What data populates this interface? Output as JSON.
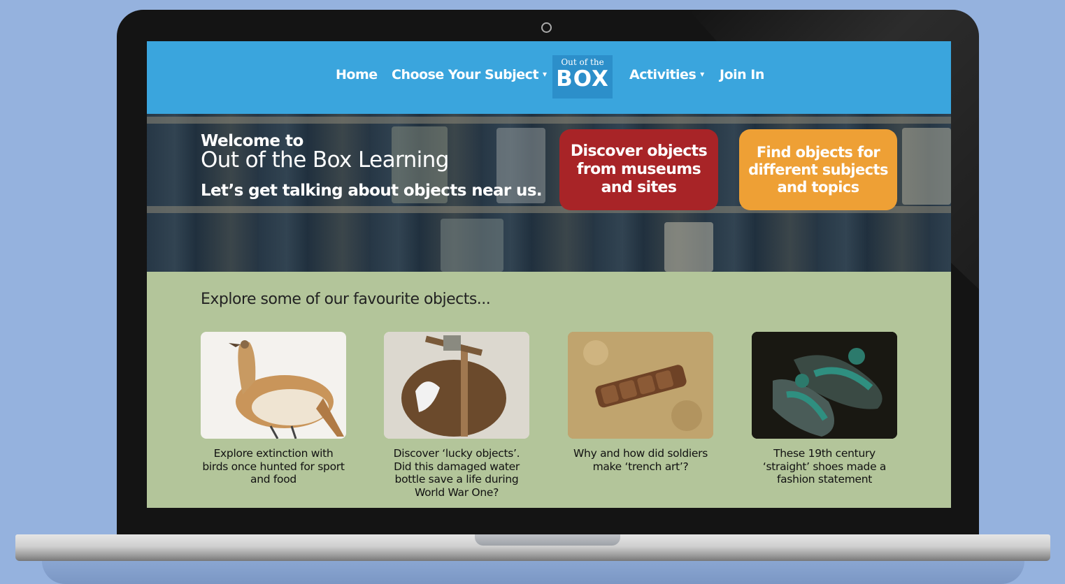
{
  "nav": {
    "home": "Home",
    "choose_subject": "Choose Your Subject",
    "activities": "Activities",
    "join_in": "Join In",
    "dropdown_caret": "⌄"
  },
  "logo": {
    "top": "Out of the",
    "main": "BOX"
  },
  "hero": {
    "welcome": "Welcome to",
    "title": "Out of the Box Learning",
    "tagline": "Let’s get talking about objects near us.",
    "cta_museums": "Discover objects from museums and sites",
    "cta_subjects": "Find objects for different subjects and topics"
  },
  "favourites": {
    "heading": "Explore some of our favourite objects...",
    "cards": [
      {
        "caption": "Explore extinction with birds once hunted for sport and food",
        "icon": "bird-photo"
      },
      {
        "caption": "Discover ‘lucky objects’. Did this damaged water bottle save a life during World War One?",
        "icon": "water-bottle-photo"
      },
      {
        "caption": "Why and how did soldiers make ‘trench art’?",
        "icon": "trench-art-photo"
      },
      {
        "caption": "These 19th century ‘straight’ shoes made a fashion statement",
        "icon": "shoes-photo"
      }
    ]
  },
  "colors": {
    "nav_bg": "#3aa5dd",
    "cta_red": "#a82427",
    "cta_orange": "#eea035",
    "content_bg": "#b3c59a",
    "page_bg": "#95b2de"
  }
}
